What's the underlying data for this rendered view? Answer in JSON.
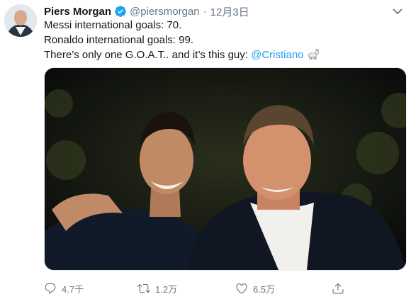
{
  "tweet": {
    "author_name": "Piers Morgan",
    "handle": "@piersmorgan",
    "separator": "·",
    "date": "12月3日",
    "lines": [
      "Messi international goals: 70.",
      "Ronaldo international goals: 99.",
      "There’s only one G.O.A.T.. and it’s this guy: "
    ],
    "mention": "@Cristiano"
  },
  "icons": {
    "verified": "verified-badge-icon",
    "more": "chevron-down-icon",
    "goat": "goat-emoji-icon",
    "reply": "reply-icon",
    "retweet": "retweet-icon",
    "like": "heart-icon",
    "share": "share-icon"
  },
  "actions": {
    "reply_count": "4.7千",
    "retweet_count": "1.2万",
    "like_count": "6.5万"
  },
  "colors": {
    "accent": "#1da1f2",
    "text": "#14171a",
    "muted": "#657786"
  }
}
